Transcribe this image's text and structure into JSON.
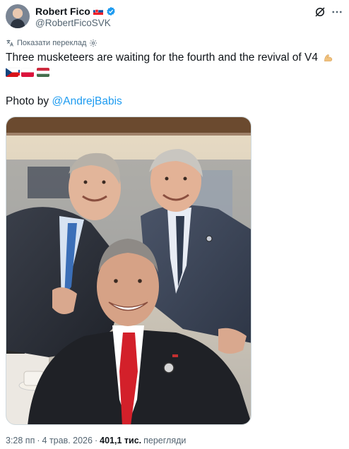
{
  "author": {
    "name": "Robert Fico",
    "handle": "@RobertFicoSVK",
    "verified": true,
    "avatar_icon": "profile-avatar"
  },
  "actions": {
    "grok_icon": "grok-icon",
    "more_icon": "more-icon"
  },
  "translate": {
    "label": "Показати переклад",
    "icon": "gear-icon"
  },
  "tweet": {
    "text": "Three musketeers are waiting for the fourth and the revival of V4",
    "emoji_flags": [
      "flexed-biceps",
      "slovakia-flag",
      "czech-flag",
      "poland-flag",
      "hungary-flag"
    ],
    "photo_by_prefix": "Photo by ",
    "photo_by_mention": "@AndrejBabis"
  },
  "photo": {
    "description_icon": "selfie-photo"
  },
  "meta": {
    "time": "3:28 пп",
    "separator1": "·",
    "date": "4 трав. 2026",
    "separator2": "·",
    "views_count": "401,1 тис.",
    "views_label": "перегляди"
  },
  "colors": {
    "link": "#1d9bf0",
    "secondary": "#536471",
    "verified": "#1d9bf0"
  }
}
